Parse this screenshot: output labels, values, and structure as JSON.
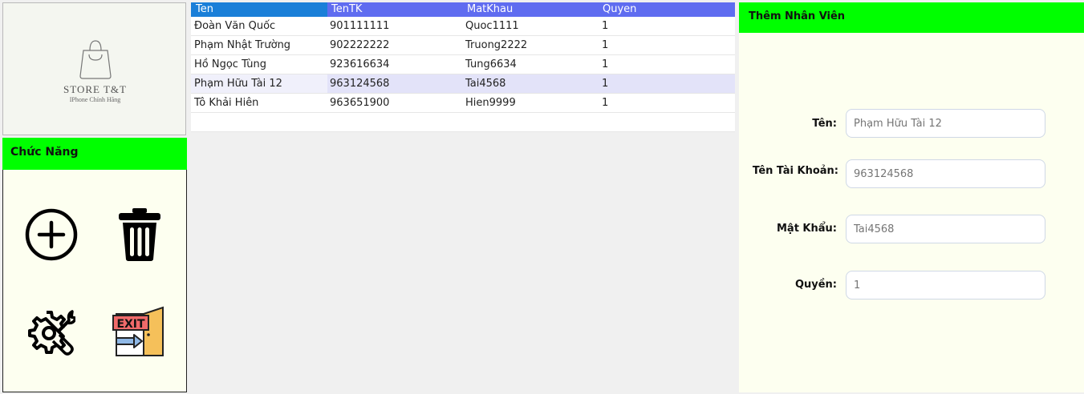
{
  "logo": {
    "title": "STORE T&T",
    "subtitle": "IPhone Chính Hãng"
  },
  "functions": {
    "header": "Chức Năng",
    "buttons": [
      {
        "name": "add-circle-icon"
      },
      {
        "name": "trash-icon"
      },
      {
        "name": "settings-wrench-icon"
      },
      {
        "name": "exit-door-icon",
        "text": "EXIT"
      }
    ]
  },
  "table": {
    "columns": [
      "Ten",
      "TenTK",
      "MatKhau",
      "Quyen"
    ],
    "rows": [
      [
        "Đoàn Văn Quốc",
        "901111111",
        "Quoc1111",
        "1"
      ],
      [
        "Phạm Nhật Trường",
        "902222222",
        "Truong2222",
        "1"
      ],
      [
        "Hồ Ngọc Tùng",
        "923616634",
        "Tung6634",
        "1"
      ],
      [
        "Phạm Hữu Tài 12",
        "963124568",
        "Tai4568",
        "1"
      ],
      [
        "Tô Khải Hiên",
        "963651900",
        "Hien9999",
        "1"
      ]
    ],
    "selected_row": 3
  },
  "form": {
    "header": "Thêm Nhân Viên",
    "name_label": "Tên:",
    "name_placeholder": "Phạm Hữu Tài 12",
    "account_label": "Tên Tài Khoản:",
    "account_placeholder": "963124568",
    "password_label": "Mật Khẩu:",
    "password_placeholder": "Tai4568",
    "role_label": "Quyền:",
    "role_placeholder": "1"
  },
  "colors": {
    "header_green": "#00ff00",
    "panel_bg": "#fdfff0",
    "grid_header": "#5f6cf0",
    "grid_header_selected": "#1a7fd8",
    "selected_row": "#e3e3f9"
  }
}
